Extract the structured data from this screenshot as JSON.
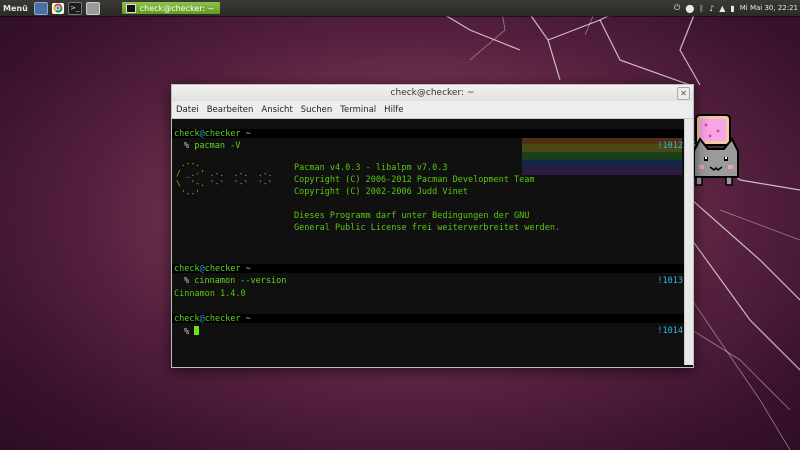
{
  "panel": {
    "menu_label": "Menü",
    "task_label": "check@checker: ~",
    "clock": "Mi Mai 30, 22:21"
  },
  "window": {
    "title": "check@checker: ~",
    "menu": [
      "Datei",
      "Bearbeiten",
      "Ansicht",
      "Suchen",
      "Terminal",
      "Hilfe"
    ]
  },
  "terminal": {
    "prompt_user": "check",
    "prompt_at": "@",
    "prompt_host": "checker",
    "prompt_dir": "~",
    "prompt_symbol": "%",
    "cmd1": "pacman -V",
    "hist1": "!1012",
    "pacman_lines": [
      "Pacman v4.0.3 - libalpm v7.0.3",
      "Copyright (C) 2006-2012 Pacman Development Team",
      "Copyright (C) 2002-2006 Judd Vinet",
      "",
      "Dieses Programm darf unter Bedingungen der GNU",
      "General Public License frei weiterverbreitet werden."
    ],
    "cmd2": "cinnamon --version",
    "hist2": "!1013",
    "output2": "Cinnamon 1.4.0",
    "hist3": "!1014"
  },
  "colors": {
    "prompt_green": "#63d61a",
    "prompt_at": "#2aa1d6",
    "history_cyan": "#2fb9d9"
  }
}
